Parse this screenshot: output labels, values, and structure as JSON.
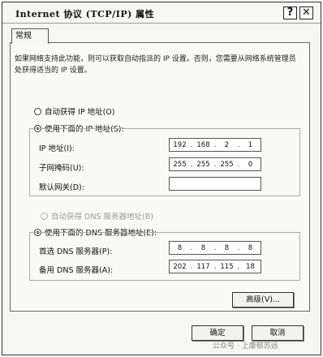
{
  "window": {
    "title": "Internet 协议 (TCP/IP) 属性",
    "help_label": "?",
    "close_label": "✕"
  },
  "tabs": [
    {
      "label": "常规"
    }
  ],
  "description": "如果网络支持此功能，则可以获取自动指派的 IP 设置。否则，您需要从网络系统管理员处获得适当的 IP 设置。",
  "ip_section": {
    "auto_label": "自动获得 IP 地址(O)",
    "manual_label": "使用下面的 IP 地址(S):",
    "selected": "manual",
    "fields": [
      {
        "label": "IP 地址(I):",
        "octets": [
          "192",
          "168",
          "2",
          "1"
        ]
      },
      {
        "label": "子网掩码(U):",
        "octets": [
          "255",
          "255",
          "255",
          "0"
        ]
      },
      {
        "label": "默认网关(D):",
        "octets": [
          "",
          "",
          "",
          ""
        ]
      }
    ]
  },
  "dns_section": {
    "auto_label": "自动获得 DNS 服务器地址(B)",
    "manual_label": "使用下面的 DNS 服务器地址(E):",
    "selected": "manual",
    "fields": [
      {
        "label": "首选 DNS 服务器(P):",
        "octets": [
          "8",
          "8",
          "8",
          "8"
        ]
      },
      {
        "label": "备用 DNS 服务器(A):",
        "octets": [
          "202",
          "117",
          "115",
          "18"
        ]
      }
    ]
  },
  "buttons": {
    "advanced": "高级(V)...",
    "ok": "确定",
    "cancel": "取消"
  },
  "watermark": "公众号 · 上康郁苏远"
}
